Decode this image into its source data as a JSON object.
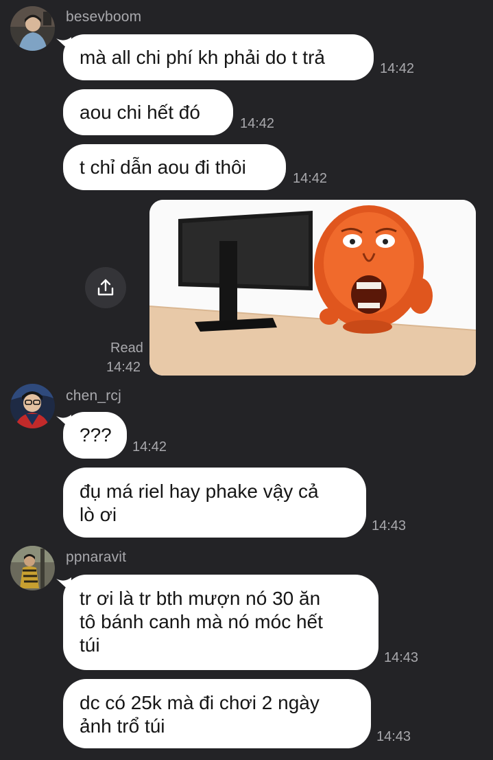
{
  "chat": {
    "groups": [
      {
        "username": "besevboom",
        "avatar_icon": "avatar-besevboom",
        "messages": [
          {
            "text": "mà all chi phí kh phải do t trả",
            "time": "14:42"
          },
          {
            "text": "aou chi hết đó",
            "time": "14:42"
          },
          {
            "text": "t chỉ dẫn aou đi thôi",
            "time": "14:42"
          }
        ]
      },
      {
        "username": "chen_rcj",
        "avatar_icon": "avatar-chen-rcj",
        "messages": [
          {
            "text": "???",
            "time": "14:42"
          },
          {
            "text": "đụ má riel hay phake vậy cả\nlò ơi",
            "time": "14:43"
          }
        ]
      },
      {
        "username": "ppnaravit",
        "avatar_icon": "avatar-ppnaravit",
        "messages": [
          {
            "text": "tr ơi là tr bth mượn nó 30 ăn\ntô bánh canh mà nó móc hết\ntúi",
            "time": "14:43"
          },
          {
            "text": "dc có 25k mà đi chơi 2 ngày\nảnh trổ túi",
            "time": "14:43"
          }
        ]
      }
    ],
    "sent_image": {
      "description_icon": "meme-image-monitor-and-shocked-face",
      "read_status": "Read",
      "time": "14:42",
      "share_icon": "share-icon"
    }
  },
  "colors": {
    "background": "#232326",
    "bubble": "#ffffff",
    "meta_text": "#a9a9ad"
  }
}
